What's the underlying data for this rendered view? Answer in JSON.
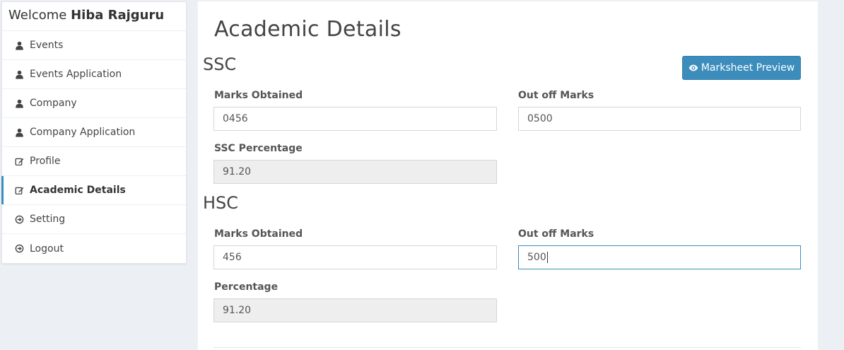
{
  "sidebar": {
    "welcome_prefix": "Welcome",
    "user_name": "Hiba Rajguru",
    "items": [
      {
        "label": "Events",
        "icon": "user-icon"
      },
      {
        "label": "Events Application",
        "icon": "user-icon"
      },
      {
        "label": "Company",
        "icon": "user-icon"
      },
      {
        "label": "Company Application",
        "icon": "user-icon"
      },
      {
        "label": "Profile",
        "icon": "edit-icon"
      },
      {
        "label": "Academic Details",
        "icon": "edit-icon",
        "active": true
      },
      {
        "label": "Setting",
        "icon": "arrow-circle-icon"
      },
      {
        "label": "Logout",
        "icon": "arrow-circle-icon"
      }
    ]
  },
  "main": {
    "title": "Academic Details",
    "preview_button": "Marksheet Preview",
    "ssc": {
      "title": "SSC",
      "marks_label": "Marks Obtained",
      "marks_value": "0456",
      "out_of_label": "Out off Marks",
      "out_of_value": "0500",
      "percentage_label": "SSC Percentage",
      "percentage_value": "91.20"
    },
    "hsc": {
      "title": "HSC",
      "marks_label": "Marks Obtained",
      "marks_value": "456",
      "out_of_label": "Out off Marks",
      "out_of_value": "500",
      "percentage_label": "Percentage",
      "percentage_value": "91.20"
    }
  },
  "colors": {
    "accent": "#3c8dbc",
    "background": "#ecf0f5",
    "readonly_field": "#eeeeee"
  }
}
